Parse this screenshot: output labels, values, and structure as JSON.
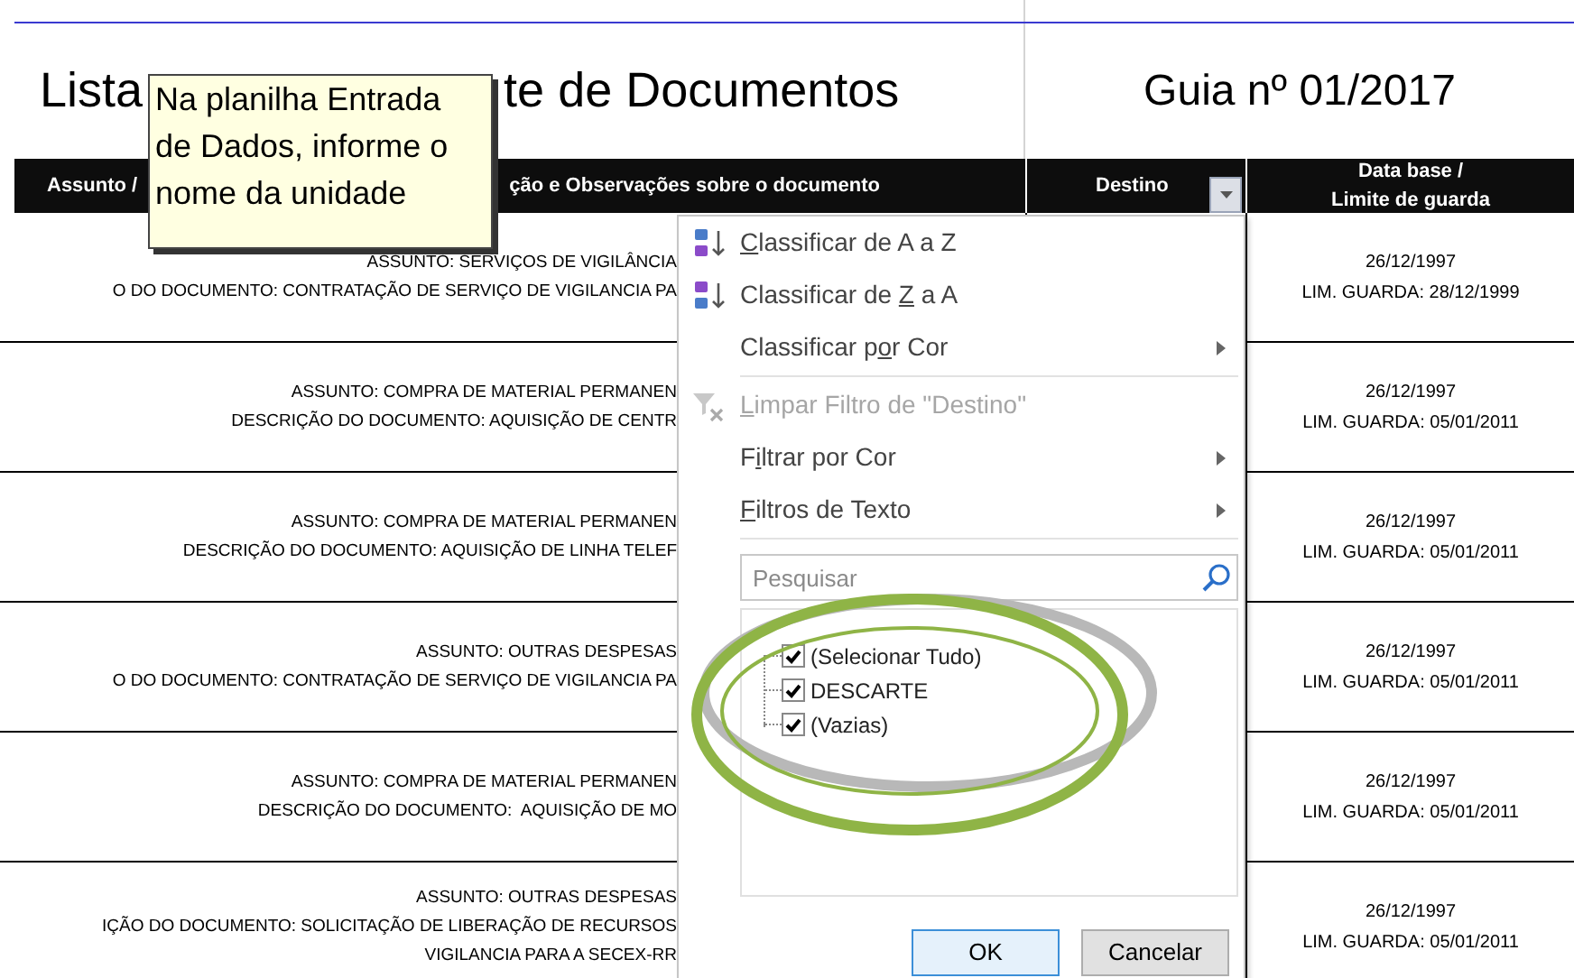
{
  "sheet": {
    "title_parts": [
      "Lista",
      "te de Documentos"
    ],
    "guide": "Guia nº 01/2017"
  },
  "tooltip": {
    "text": "Na planilha Entrada de Dados, informe o nome da unidade"
  },
  "table": {
    "columns": [
      {
        "kind": "split",
        "parts": [
          "Assunto /",
          "ção e Observações sobre o documento"
        ]
      },
      {
        "kind": "filter",
        "label": "Destino",
        "filter_open": true
      },
      {
        "kind": "lines",
        "lines": [
          "Data base /",
          "Limite de guarda"
        ]
      }
    ],
    "rows": [
      {
        "description": [
          "ASSUNTO: SERVIÇOS DE VIGILÂNCIA",
          "O DO DOCUMENTO: CONTRATAÇÃO DE SERVIÇO DE VIGILANCIA PA"
        ],
        "dates": [
          "26/12/1997",
          "LIM. GUARDA: 28/12/1999"
        ]
      },
      {
        "description": [
          "ASSUNTO: COMPRA DE MATERIAL PERMANEN",
          "DESCRIÇÃO DO DOCUMENTO: AQUISIÇÃO DE CENTR"
        ],
        "dates": [
          "26/12/1997",
          "LIM. GUARDA: 05/01/2011"
        ]
      },
      {
        "description": [
          "ASSUNTO: COMPRA DE MATERIAL PERMANEN",
          "DESCRIÇÃO DO DOCUMENTO: AQUISIÇÃO DE LINHA TELEF"
        ],
        "dates": [
          "26/12/1997",
          "LIM. GUARDA: 05/01/2011"
        ]
      },
      {
        "description": [
          "ASSUNTO: OUTRAS DESPESAS",
          "O DO DOCUMENTO: CONTRATAÇÃO DE SERVIÇO DE VIGILANCIA PA"
        ],
        "dates": [
          "26/12/1997",
          "LIM. GUARDA: 05/01/2011"
        ]
      },
      {
        "description": [
          "ASSUNTO: COMPRA DE MATERIAL PERMANEN",
          "DESCRIÇÃO DO DOCUMENTO:  AQUISIÇÃO DE MO"
        ],
        "dates": [
          "26/12/1997",
          "LIM. GUARDA: 05/01/2011"
        ]
      },
      {
        "description": [
          "ASSUNTO: OUTRAS DESPESAS",
          "IÇÃO DO DOCUMENTO: SOLICITAÇÃO DE LIBERAÇÃO DE RECURSOS",
          "VIGILANCIA PARA A SECEX-RR"
        ],
        "dates": [
          "26/12/1997",
          "LIM. GUARDA: 05/01/2011"
        ]
      }
    ]
  },
  "filter_menu": {
    "items": [
      {
        "kind": "sort-ascending",
        "key": "C",
        "after": "lassificar de A a Z",
        "disabled": false,
        "submenu": false
      },
      {
        "kind": "sort-descending",
        "before": "Classificar de ",
        "key": "Z",
        "after": " a A",
        "disabled": false,
        "submenu": false
      },
      {
        "kind": "command",
        "before": "Classificar p",
        "key": "o",
        "after": "r Cor",
        "disabled": false,
        "submenu": true
      },
      {
        "kind": "separator"
      },
      {
        "kind": "clear-filter",
        "key": "L",
        "after": "impar Filtro de \"Destino\"",
        "disabled": true,
        "submenu": false
      },
      {
        "kind": "command",
        "before": "F",
        "key": "i",
        "after": "ltrar por Cor",
        "disabled": false,
        "submenu": true
      },
      {
        "kind": "command",
        "key": "F",
        "after": "iltros de Texto",
        "disabled": false,
        "submenu": true
      },
      {
        "kind": "separator"
      }
    ],
    "search": {
      "placeholder": "Pesquisar"
    },
    "values": [
      {
        "label": "(Selecionar Tudo)",
        "checked": true
      },
      {
        "label": "DESCARTE",
        "checked": true
      },
      {
        "label": "(Vazias)",
        "checked": true
      }
    ],
    "buttons": [
      {
        "label": "OK",
        "default": true
      },
      {
        "label": "Cancelar",
        "default": false
      }
    ]
  }
}
